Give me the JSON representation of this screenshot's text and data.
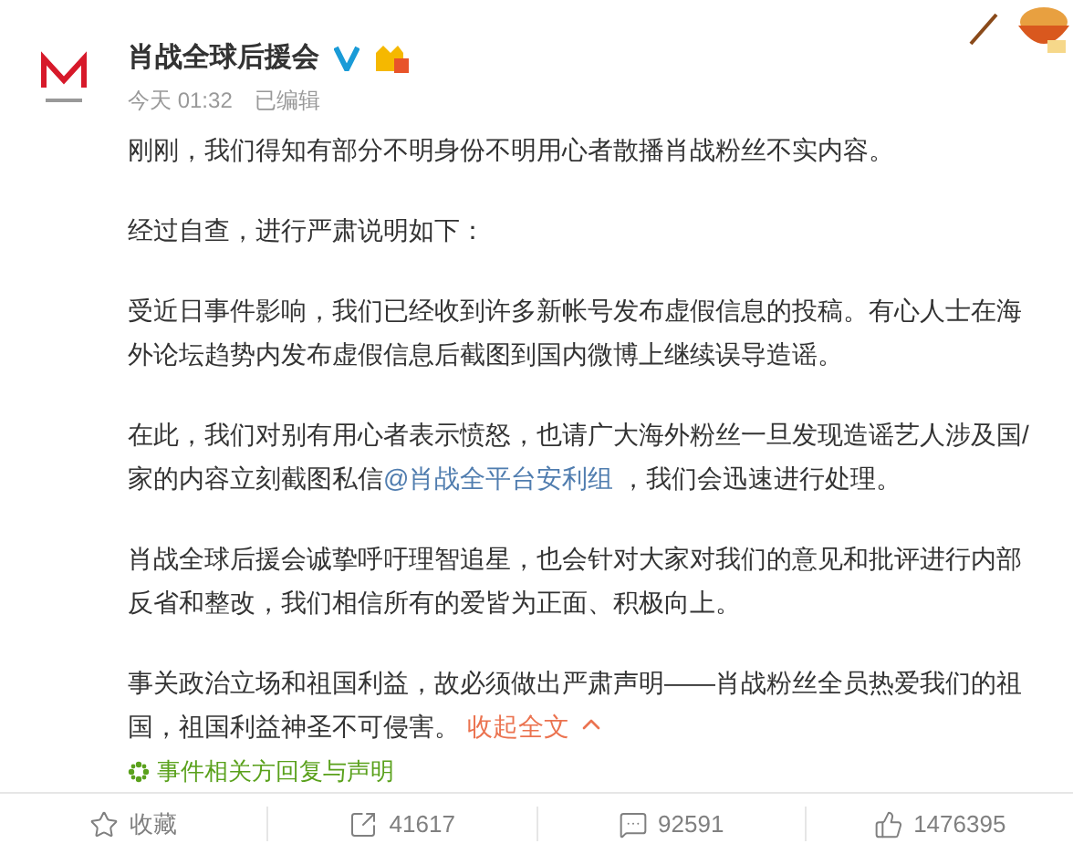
{
  "post": {
    "author": "肖战全球后援会",
    "time": "今天 01:32",
    "edited": "已编辑",
    "paragraphs": [
      [
        {
          "kind": "text",
          "text": "刚刚，我们得知有部分不明身份不明用心者散播肖战粉丝不实内容。"
        }
      ],
      [
        {
          "kind": "text",
          "text": "经过自查，进行严肃说明如下："
        }
      ],
      [
        {
          "kind": "text",
          "text": "受近日事件影响，我们已经收到许多新帐号发布虚假信息的投稿。有心人士在海外论坛趋势内发布虚假信息后截图到国内微博上继续误导造谣。"
        }
      ],
      [
        {
          "kind": "text",
          "text": "在此，我们对别有用心者表示愤怒，也请广大海外粉丝一旦发现造谣艺人涉及国/家的内容立刻截图私信"
        },
        {
          "kind": "mention",
          "text": "@肖战全平台安利组"
        },
        {
          "kind": "text",
          "text": " ，我们会迅速进行处理。"
        }
      ],
      [
        {
          "kind": "text",
          "text": "肖战全球后援会诚挚呼吁理智追星，也会针对大家对我们的意见和批评进行内部反省和整改，我们相信所有的爱皆为正面、积极向上。"
        }
      ],
      [
        {
          "kind": "text",
          "text": "事关政治立场和祖国利益，故必须做出严肃声明——肖战粉丝全员热爱我们的祖国，祖国利益神圣不可侵害。 "
        },
        {
          "kind": "collapse",
          "text": "收起全文"
        }
      ]
    ],
    "topic": "事件相关方回复与声明"
  },
  "actions": [
    {
      "kind": "favorite",
      "label": "收藏"
    },
    {
      "kind": "repost",
      "label": "41617"
    },
    {
      "kind": "comment",
      "label": "92591"
    },
    {
      "kind": "like",
      "label": "1476395"
    }
  ]
}
